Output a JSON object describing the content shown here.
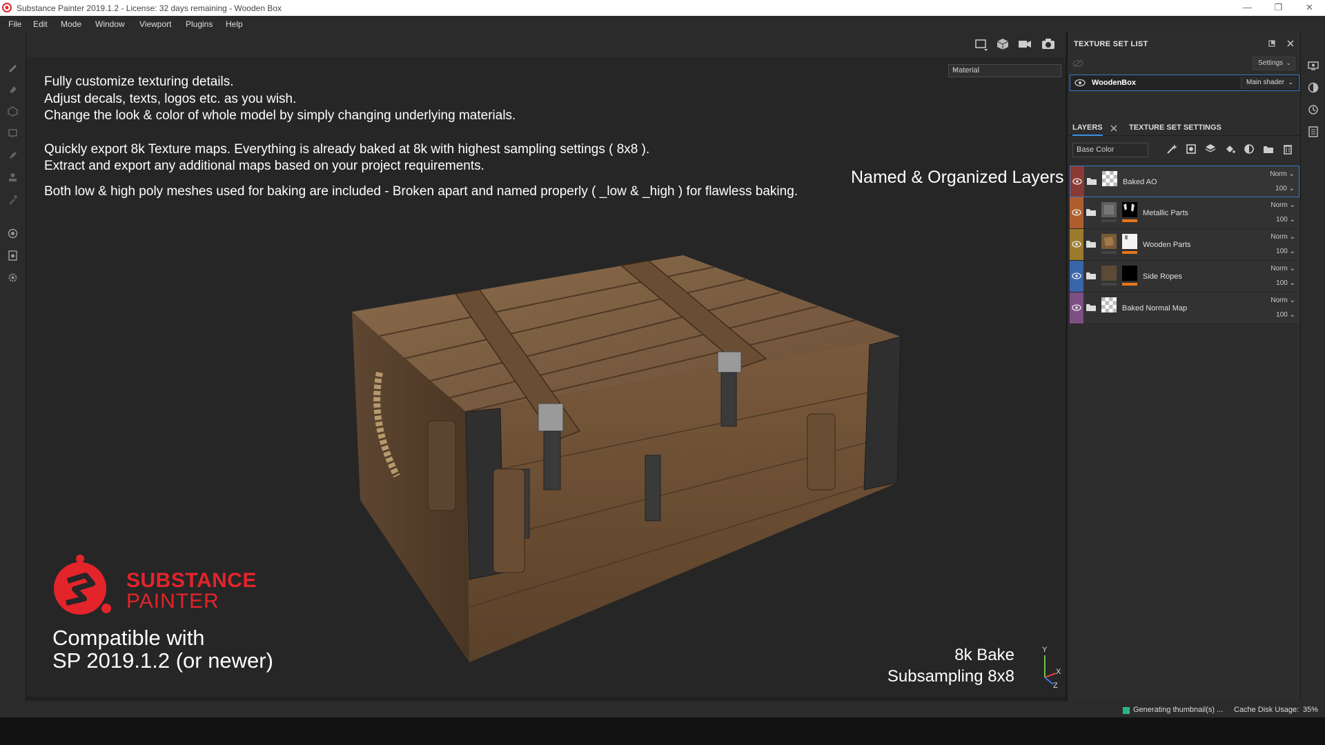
{
  "app": {
    "title": "Substance Painter 2019.1.2 - License: 32 days remaining - Wooden Box",
    "window_buttons": [
      "—",
      "❐",
      "✕"
    ]
  },
  "menu": [
    "File",
    "Edit",
    "Mode",
    "Window",
    "Viewport",
    "Plugins",
    "Help"
  ],
  "viewport": {
    "material_mode": "Material",
    "desc_lines": [
      "Fully customize texturing details.",
      "Adjust decals, texts, logos etc. as you wish.",
      "Change the look & color of whole model by simply changing underlying materials.",
      "Quickly export 8k Texture maps. Everything is already baked at 8k with highest sampling settings ( 8x8 ).",
      "Extract and export any additional maps based on your project requirements.",
      "Both low & high poly meshes used for baking are included - Broken apart and named properly ( _low & _high ) for flawless baking."
    ],
    "named_layers": "Named & Organized Layers",
    "brand_line1": "SUBSTANCE",
    "brand_line2": "PAINTER",
    "compat_line1": "Compatible with",
    "compat_line2": "SP 2019.1.2 (or newer)",
    "bake_line1": "8k Bake",
    "bake_line2": "Subsampling 8x8",
    "axis_y": "Y",
    "axis_x": "X",
    "axis_z": "Z"
  },
  "texture_set_list": {
    "header": "TEXTURE SET LIST",
    "settings_label": "Settings",
    "set_name": "WoodenBox",
    "shader_label": "Main shader"
  },
  "layers_panel": {
    "tab_layers": "LAYERS",
    "tab_tss": "TEXTURE SET SETTINGS",
    "channel": "Base Color",
    "items": [
      {
        "name": "Baked AO",
        "blend": "Norm",
        "opacity": "100",
        "color": "#8a3a34"
      },
      {
        "name": "Metallic Parts",
        "blend": "Norm",
        "opacity": "100",
        "color": "#b05d2e"
      },
      {
        "name": "Wooden Parts",
        "blend": "Norm",
        "opacity": "100",
        "color": "#9b7a2c"
      },
      {
        "name": "Side Ropes",
        "blend": "Norm",
        "opacity": "100",
        "color": "#3a64a8"
      },
      {
        "name": "Baked Normal Map",
        "blend": "Norm",
        "opacity": "100",
        "color": "#7d4f82"
      }
    ]
  },
  "status": {
    "generating": "Generating thumbnail(s) ...",
    "cache_label": "Cache Disk Usage:",
    "cache_value": "35%"
  },
  "colors": {
    "accent": "#3a78c6",
    "brand_red": "#e3242b",
    "status_green": "#2bb58c"
  }
}
